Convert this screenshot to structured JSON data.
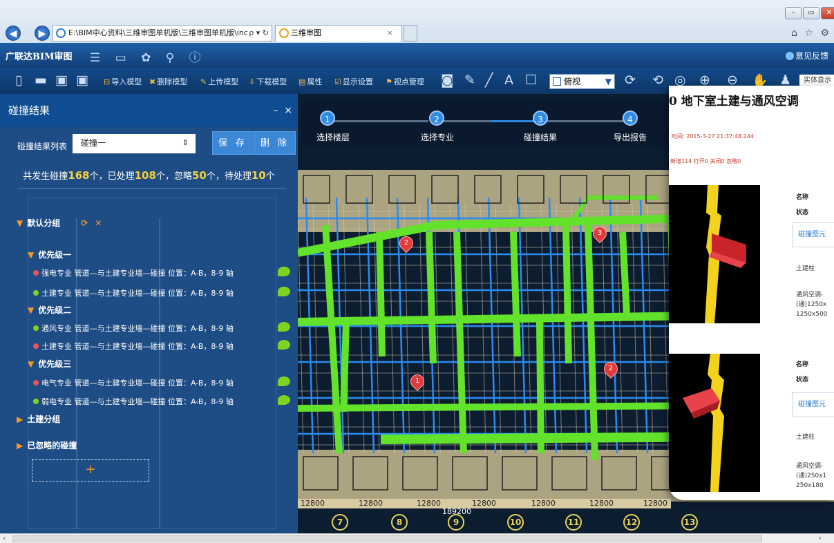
{
  "browser": {
    "address": "E:\\BIM中心资料\\三维审图单机版\\三维审图单机版\\inc",
    "address_controls": "ρ ▾ ↻",
    "tab_title": "三维审图",
    "tab_close": "×",
    "win_min": "–",
    "win_max": "▭",
    "win_close": "✕",
    "icons": "⌂ ☆ ⚙"
  },
  "app": {
    "logo": "广联达BIM审图",
    "icons": "☰ ▭ ✿ ⚲ ⓘ",
    "feedback": "意见反馈"
  },
  "toolbar": {
    "import": "导入模型",
    "delete": "删除模型",
    "upload": "上传模型",
    "download": "下载模型",
    "props": "属性",
    "display": "显示设置",
    "viewpoint": "视点管理",
    "view_select": "俯视",
    "search_placeholder": "实体显示"
  },
  "panel": {
    "title": "碰撞结果",
    "min": "–",
    "close": "×",
    "list_label": "碰撞结果列表",
    "collision_select": "碰撞一",
    "save": "保 存",
    "delete": "删 除",
    "summary": {
      "prefix": "共发生碰撞",
      "total": "168",
      "t1": "个，已处理",
      "handled": "108",
      "t2": "个，忽略",
      "ignored": "50",
      "t3": "个，待处理",
      "pending": "10",
      "t4": "个"
    },
    "default_group": "默认分组",
    "priority": [
      {
        "label": "优先级一",
        "items": [
          {
            "color": "#e8555a",
            "text": "强电专业 管道—与土建专业墙—碰撞  位置：A-B，8-9 轴"
          },
          {
            "color": "#7ed321",
            "text": "土建专业 管道—与土建专业墙—碰撞  位置：A-B，8-9 轴"
          }
        ]
      },
      {
        "label": "优先级二",
        "items": [
          {
            "color": "#7ed321",
            "text": "通风专业 管道—与土建专业墙—碰撞  位置：A-B，8-9 轴"
          },
          {
            "color": "#e8555a",
            "text": "土建专业 管道—与土建专业墙—碰撞  位置：A-B，8-9 轴"
          }
        ]
      },
      {
        "label": "优先级三",
        "items": [
          {
            "color": "#e8555a",
            "text": "电气专业 管道—与土建专业墙—碰撞  位置：A-B，8-9 轴"
          },
          {
            "color": "#7ed321",
            "text": "弱电专业 管道—与土建专业墙—碰撞  位置：A-B，8-9 轴"
          }
        ]
      }
    ],
    "civil_group": "土建分组",
    "ignored_group": "已忽略的碰撞",
    "add": "+"
  },
  "steps": [
    {
      "num": "1",
      "label": "选择楼层"
    },
    {
      "num": "2",
      "label": "选择专业"
    },
    {
      "num": "3",
      "label": "碰撞结果"
    },
    {
      "num": "4",
      "label": "导出报告"
    }
  ],
  "markers": [
    "2",
    "3",
    "1",
    "2"
  ],
  "axis": {
    "dims": [
      "12800",
      "12800",
      "12800",
      "12800",
      "12800",
      "12800",
      "12800"
    ],
    "total": "189200",
    "circles": [
      "7",
      "8",
      "9",
      "10",
      "11",
      "12",
      "13"
    ]
  },
  "detail": {
    "title": "0 地下室土建与通风空调",
    "time": "时间: 2015-3-27 21:37:48.244",
    "status": "新增114  打开0  关闭0  忽略0",
    "name_label": "名称",
    "status_label": "状态",
    "link": "碰撞图元",
    "civil": "土建柱",
    "vent1": "通风空调-\n(通)1250x\n1250x500",
    "vent2": "通风空调-\n(通)250x1\n250x180"
  },
  "colors": {
    "panel_bg": "#12427e",
    "accent_yellow": "#f7d23b",
    "duct_green": "#62e22a",
    "pipe_blue": "#2a8cf0",
    "marker_red": "#e23b3b"
  }
}
